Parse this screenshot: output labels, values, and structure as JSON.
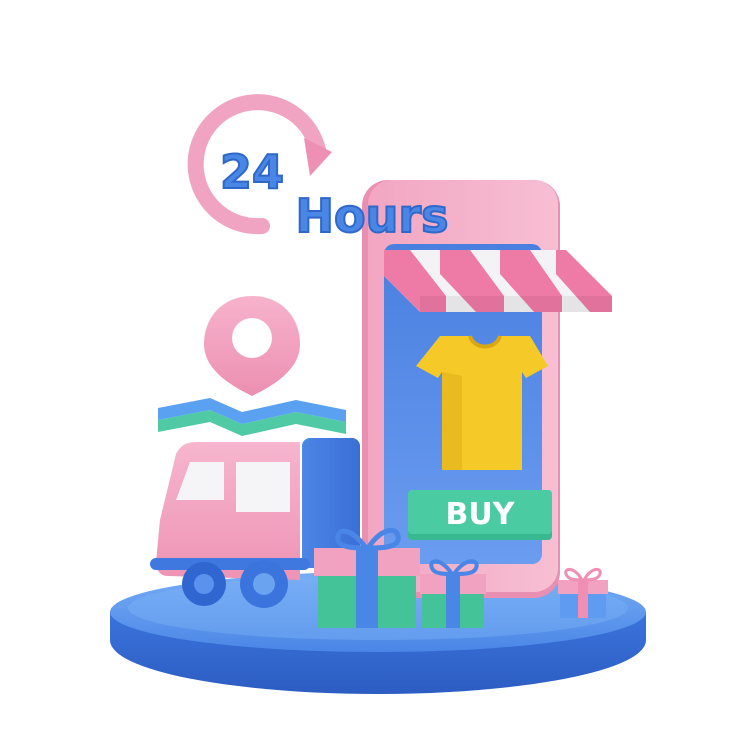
{
  "scene": {
    "hours_number": "24",
    "hours_word": "Hours",
    "buy_label": "BUY"
  },
  "colors": {
    "pink": "#f08fb3",
    "pink_light": "#f7b6cd",
    "blue": "#3f79e0",
    "blue_light": "#6aa3f0",
    "green": "#3fc39a",
    "yellow": "#f4c62a",
    "white": "#ffffff"
  }
}
